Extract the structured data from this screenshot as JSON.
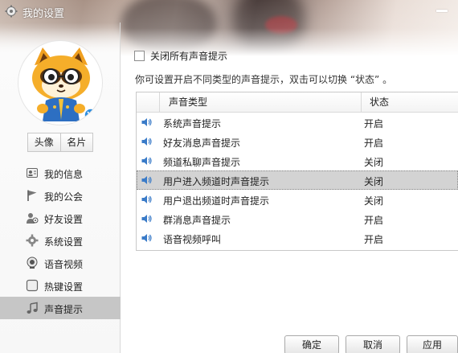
{
  "window": {
    "title": "我的设置",
    "icons": {
      "app": "gear-icon",
      "minimize": "minimize-icon"
    }
  },
  "sidebar": {
    "avatar_icon": "raccoon-mascot-avatar",
    "avatar_tabs": [
      {
        "label": "头像"
      },
      {
        "label": "名片"
      }
    ],
    "items": [
      {
        "label": "我的信息",
        "icon": "id-card-icon"
      },
      {
        "label": "我的公会",
        "icon": "flag-icon"
      },
      {
        "label": "好友设置",
        "icon": "friend-settings-icon"
      },
      {
        "label": "系统设置",
        "icon": "gear-icon"
      },
      {
        "label": "语音视频",
        "icon": "webcam-icon"
      },
      {
        "label": "热键设置",
        "icon": "hotkey-icon"
      },
      {
        "label": "声音提示",
        "icon": "music-note-icon"
      }
    ],
    "active_item": "声音提示"
  },
  "content": {
    "mute_all_label": "关闭所有声音提示",
    "mute_all_checked": false,
    "hint": "你可设置开启不同类型的声音提示，双击可以切换 “状态” 。",
    "table": {
      "columns": [
        "声音类型",
        "状态"
      ],
      "rows": [
        {
          "name": "系统声音提示",
          "state": "开启"
        },
        {
          "name": "好友消息声音提示",
          "state": "开启"
        },
        {
          "name": "频道私聊声音提示",
          "state": "关闭"
        },
        {
          "name": "用户进入频道时声音提示",
          "state": "关闭"
        },
        {
          "name": "用户退出频道时声音提示",
          "state": "关闭"
        },
        {
          "name": "群消息声音提示",
          "state": "开启"
        },
        {
          "name": "语音视频呼叫",
          "state": "开启"
        }
      ],
      "selected_row": "用户进入频道时声音提示",
      "row_icon": "speaker-icon"
    }
  },
  "buttons": {
    "ok": "确定",
    "cancel": "取消",
    "apply": "应用"
  },
  "colors": {
    "selected_nav": "#c6c6c6",
    "selected_row": "#d3d3d3",
    "speaker_blue": "#3a7bc8"
  }
}
